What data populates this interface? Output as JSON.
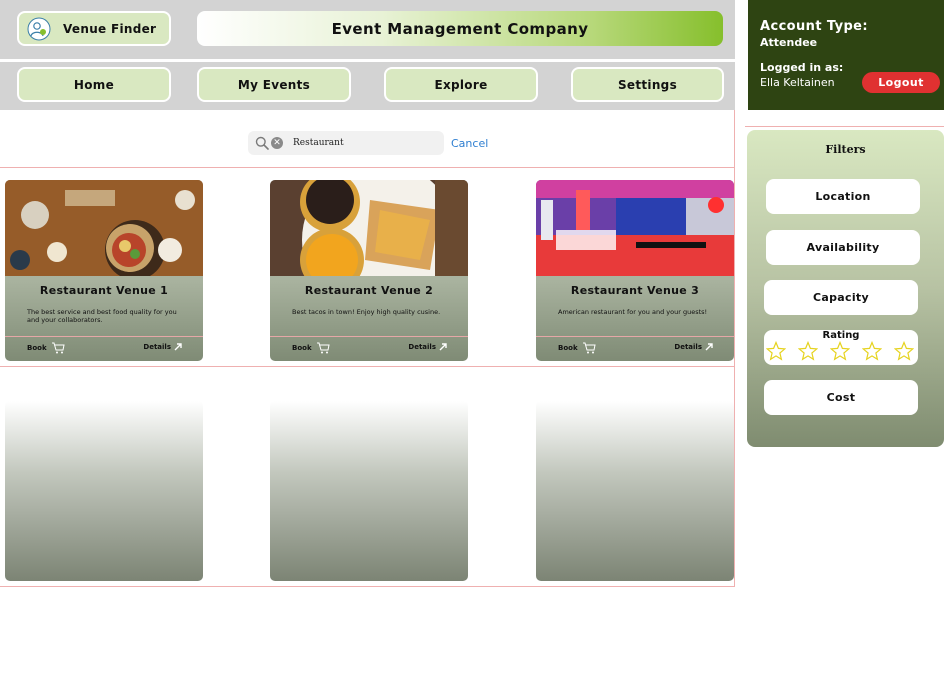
{
  "header": {
    "app_button": "Venue Finder",
    "company_title": "Event Management Company"
  },
  "nav": {
    "home": "Home",
    "my_events": "My Events",
    "explore": "Explore",
    "settings": "Settings"
  },
  "account": {
    "type_label": "Account Type:",
    "type_value": "Attendee",
    "logged_label": "Logged in as:",
    "user_name": "Ella Keltainen",
    "logout": "Logout"
  },
  "search": {
    "value": "Restaurant",
    "cancel": "Cancel"
  },
  "cards": [
    {
      "name": "Restaurant Venue 1",
      "desc": "The best service and best food quality for you and your collaborators.",
      "book": "Book",
      "details": "Details"
    },
    {
      "name": "Restaurant Venue 2",
      "desc": "Best tacos in town! Enjoy high quality cusine.",
      "book": "Book",
      "details": "Details"
    },
    {
      "name": "Restaurant Venue 3",
      "desc": "American restaurant for you and your guests!",
      "book": "Book",
      "details": "Details"
    }
  ],
  "filters": {
    "title": "Filters",
    "location": "Location",
    "availability": "Availability",
    "capacity": "Capacity",
    "rating": "Rating",
    "cost": "Cost"
  },
  "colors": {
    "accent_green": "#86bf2c",
    "pill_green": "#d9e8c1",
    "account_bg": "#2e4412",
    "logout_red": "#e03131",
    "link_blue": "#2f7fd1"
  }
}
